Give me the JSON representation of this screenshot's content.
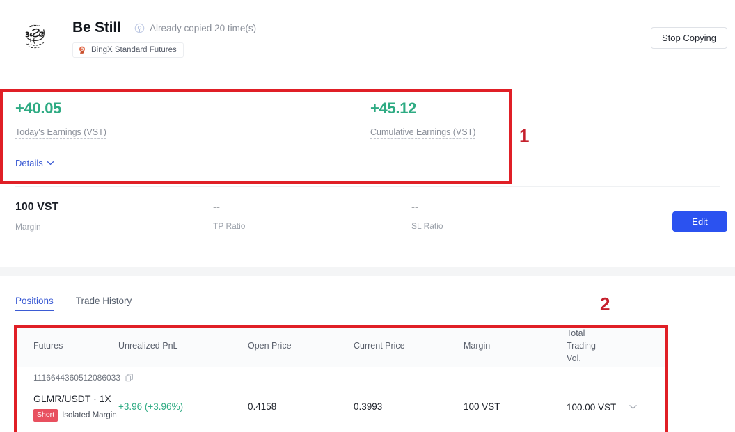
{
  "header": {
    "avatar_name": "be-still-script-logo",
    "trader_name": "Be Still",
    "copied_icon": "copy-trade-icon",
    "copied_text": "Already copied 20 time(s)",
    "badge_icon": "medal-icon",
    "badge_label": "BingX Standard Futures",
    "stop_copying_label": "Stop Copying"
  },
  "earnings": {
    "today": {
      "value": "+40.05",
      "label": "Today's Earnings (VST)"
    },
    "cumulative": {
      "value": "+45.12",
      "label": "Cumulative Earnings (VST)"
    },
    "details_label": "Details",
    "details_chevron": "chevron-down-icon",
    "positive_color": "#2eab83"
  },
  "settings_row": {
    "margin": {
      "value": "100 VST",
      "label": "Margin"
    },
    "tp_ratio": {
      "value": "--",
      "label": "TP Ratio"
    },
    "sl_ratio": {
      "value": "--",
      "label": "SL Ratio"
    },
    "edit_label": "Edit",
    "edit_color": "#2b52f0"
  },
  "tabs": [
    {
      "label": "Positions",
      "active": true
    },
    {
      "label": "Trade History",
      "active": false
    }
  ],
  "table": {
    "columns": [
      "Futures",
      "Unrealized PnL",
      "Open Price",
      "Current Price",
      "Margin",
      "Total Trading Vol."
    ],
    "order_id": "1116644360512086033",
    "copy_icon": "copy-icon",
    "rows": [
      {
        "symbol": "GLMR/USDT · 1X",
        "side": "Short",
        "margin_mode": "Isolated Margin",
        "unrealized_pnl": "+3.96 (+3.96%)",
        "open_price": "0.4158",
        "current_price": "0.3993",
        "margin": "100 VST",
        "total_trading_vol": "100.00 VST",
        "expand_icon": "chevron-down-icon"
      }
    ]
  },
  "annotations": [
    {
      "number": "1",
      "color": "#c5202c"
    },
    {
      "number": "2",
      "color": "#c5202c"
    }
  ]
}
